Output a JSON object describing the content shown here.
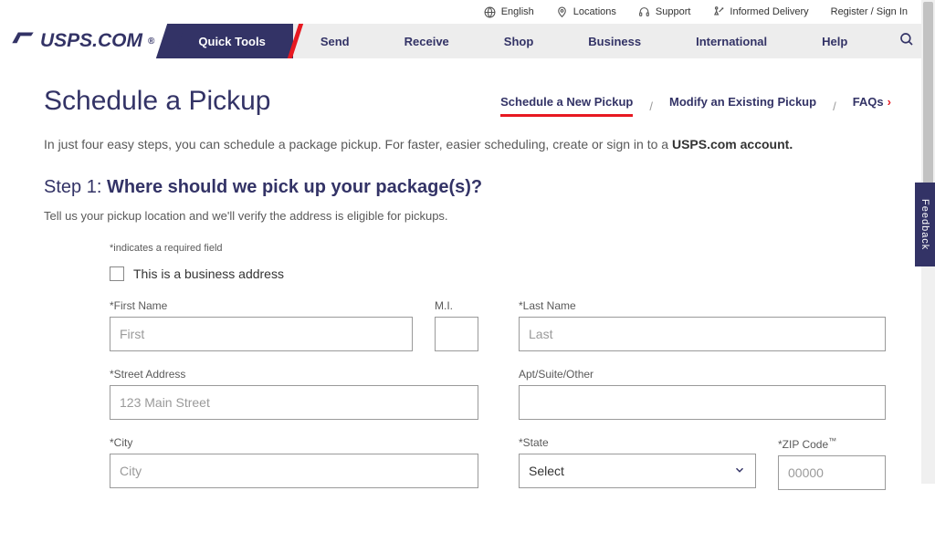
{
  "utility": {
    "language": "English",
    "locations": "Locations",
    "support": "Support",
    "informed": "Informed Delivery",
    "register": "Register / Sign In"
  },
  "logo": "USPS.COM",
  "nav": {
    "quick_tools": "Quick Tools",
    "send": "Send",
    "receive": "Receive",
    "shop": "Shop",
    "business": "Business",
    "international": "International",
    "help": "Help"
  },
  "page_title": "Schedule a Pickup",
  "subtabs": {
    "new": "Schedule a New Pickup",
    "modify": "Modify an Existing Pickup",
    "faqs": "FAQs"
  },
  "intro_prefix": "In just four easy steps, you can schedule a package pickup. For faster, easier scheduling, create or sign in to a ",
  "intro_link": "USPS.com account.",
  "step1_prefix": "Step 1: ",
  "step1_q": "Where should we pick up your package(s)?",
  "step1_desc": "Tell us your pickup location and we'll verify the address is eligible for pickups.",
  "req_note": "*indicates a required field",
  "cb_business": "This is a business address",
  "labels": {
    "first": "*First Name",
    "mi": "M.I.",
    "last": "*Last Name",
    "street": "*Street Address",
    "apt": "Apt/Suite/Other",
    "city": "*City",
    "state": "*State",
    "zip_prefix": "*ZIP Code"
  },
  "placeholders": {
    "first": "First",
    "last": "Last",
    "street": "123 Main Street",
    "city": "City",
    "zip": "00000"
  },
  "state_selected": "Select",
  "feedback": "Feedback"
}
